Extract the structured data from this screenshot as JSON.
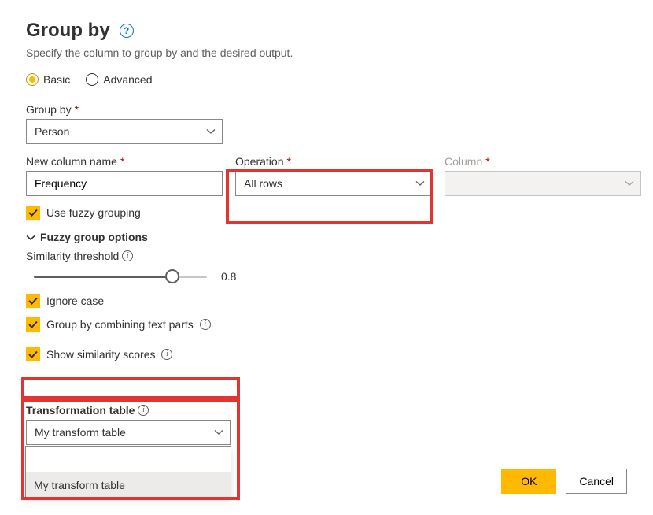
{
  "title": "Group by",
  "subtitle": "Specify the column to group by and the desired output.",
  "mode": {
    "basic": "Basic",
    "advanced": "Advanced"
  },
  "groupBy": {
    "label": "Group by",
    "value": "Person"
  },
  "newCol": {
    "label": "New column name",
    "value": "Frequency"
  },
  "operation": {
    "label": "Operation",
    "value": "All rows"
  },
  "column": {
    "label": "Column",
    "value": ""
  },
  "fuzzy": {
    "useFuzzy": "Use fuzzy grouping",
    "optionsHeader": "Fuzzy group options",
    "thresholdLabel": "Similarity threshold",
    "thresholdValue": "0.8",
    "ignoreCase": "Ignore case",
    "combineParts": "Group by combining text parts",
    "showScores": "Show similarity scores",
    "transTableLabel": "Transformation table",
    "transTableValue": "My transform table",
    "transTableOption": "My transform table"
  },
  "buttons": {
    "ok": "OK",
    "cancel": "Cancel"
  }
}
